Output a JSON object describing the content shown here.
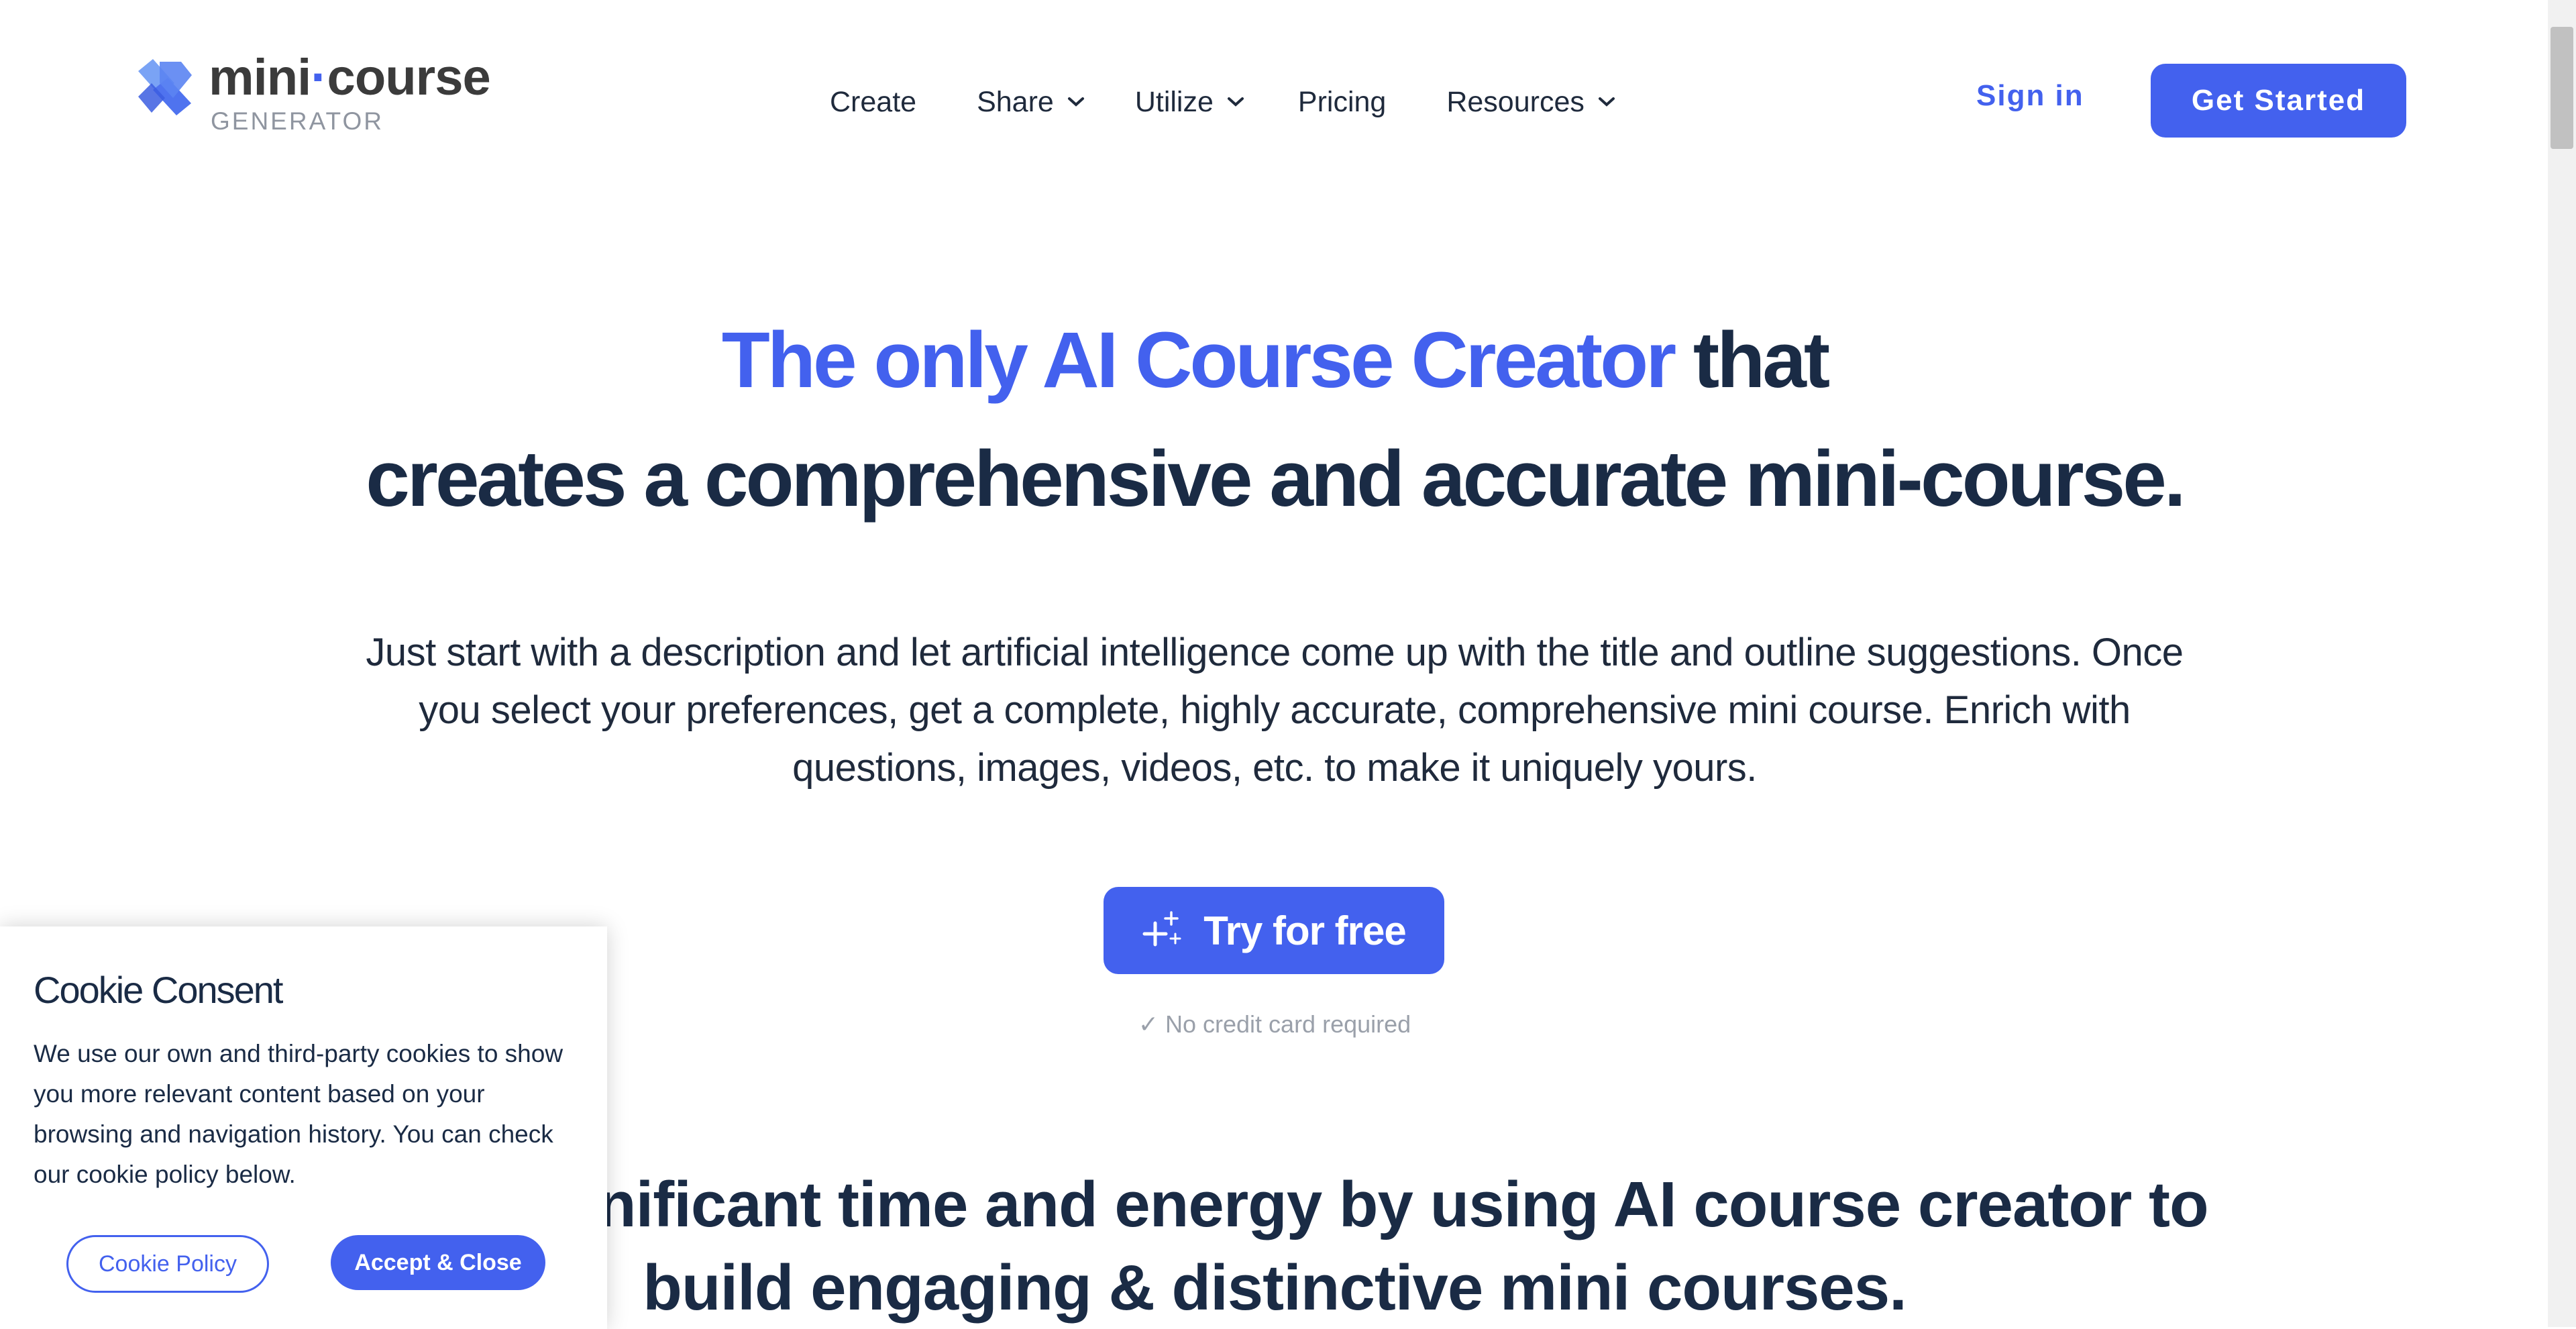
{
  "brand": {
    "name_part1": "mini",
    "name_dot": "·",
    "name_part2": "course",
    "tagline": "GENERATOR",
    "accent_color": "#4361ee"
  },
  "nav": {
    "items": [
      {
        "label": "Create",
        "has_dropdown": false
      },
      {
        "label": "Share",
        "has_dropdown": true
      },
      {
        "label": "Utilize",
        "has_dropdown": true
      },
      {
        "label": "Pricing",
        "has_dropdown": false
      },
      {
        "label": "Resources",
        "has_dropdown": true
      }
    ],
    "sign_in": "Sign in",
    "get_started": "Get Started"
  },
  "hero": {
    "title_accent": "The only AI Course Creator",
    "title_rest": " that",
    "title_line2": "creates a comprehensive and accurate mini-course.",
    "description": "Just start with a description and let artificial intelligence come up with the title and outline suggestions. Once you select your preferences, get a complete, highly accurate, comprehensive mini course. Enrich with questions, images, videos, etc. to make it uniquely yours.",
    "cta_label": "Try for free",
    "cta_icon": "sparkles-icon",
    "note": "✓ No credit card required"
  },
  "section2": {
    "line1": "Save significant time and energy by using AI course creator to",
    "line2": "build engaging & distinctive mini courses."
  },
  "cookie": {
    "title": "Cookie Consent",
    "text": "We use our own and third-party cookies to show you more relevant content based on your browsing and navigation history. You can check our cookie policy below.",
    "policy_button": "Cookie Policy",
    "accept_button": "Accept & Close"
  }
}
